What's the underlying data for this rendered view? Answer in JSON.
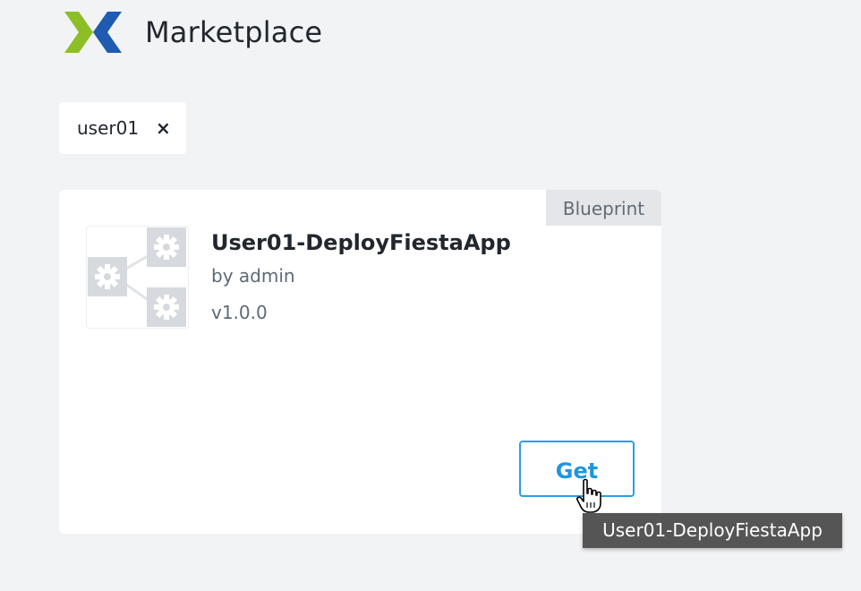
{
  "header": {
    "title": "Marketplace",
    "logo_icon": "nutanix-x-logo-icon",
    "colors": {
      "green": "#8cbe25",
      "blue": "#1f5bb0"
    }
  },
  "filter": {
    "chip_label": "user01",
    "close_glyph": "×"
  },
  "card": {
    "type_badge": "Blueprint",
    "name": "User01-DeployFiestaApp",
    "author": "by admin",
    "version": "v1.0.0",
    "thumbnail_icon": "blueprint-gears-icon",
    "get_label": "Get"
  },
  "tooltip": {
    "text": "User01-DeployFiestaApp"
  },
  "colors": {
    "background": "#f2f3f5",
    "accent": "#1f95e0",
    "badge_bg": "#e4e6e9",
    "tooltip_bg": "#555555"
  }
}
